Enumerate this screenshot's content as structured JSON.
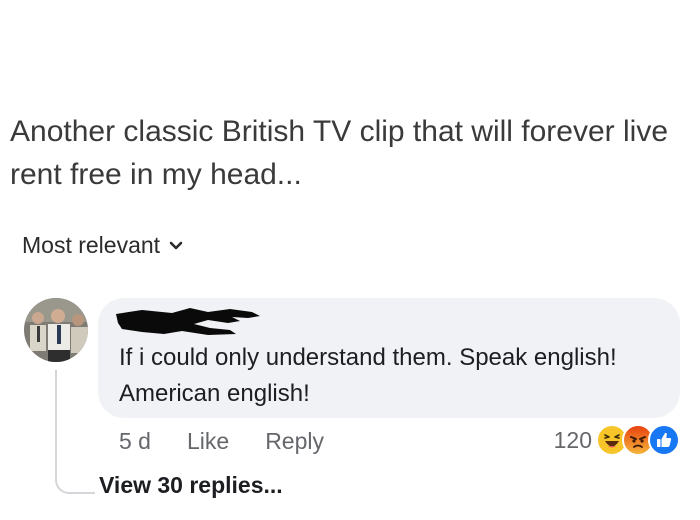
{
  "post": {
    "text": "Another classic British TV clip that will forever live rent free in my head..."
  },
  "sort": {
    "label": "Most relevant",
    "icon": "chevron-down-icon"
  },
  "comment": {
    "author_redacted": true,
    "text": "If i could only understand them. Speak english! American english!",
    "time": "5 d",
    "like_label": "Like",
    "reply_label": "Reply",
    "reaction_count": "120",
    "reactions": [
      "haha-icon",
      "angry-icon",
      "like-icon"
    ],
    "view_replies_label": "View 30 replies..."
  },
  "colors": {
    "bubble": "#f0f2f5",
    "meta_text": "#65676b",
    "like_blue": "#1877f2",
    "haha_yellow": "#f7c52a",
    "angry_orange": "#e9710f"
  }
}
